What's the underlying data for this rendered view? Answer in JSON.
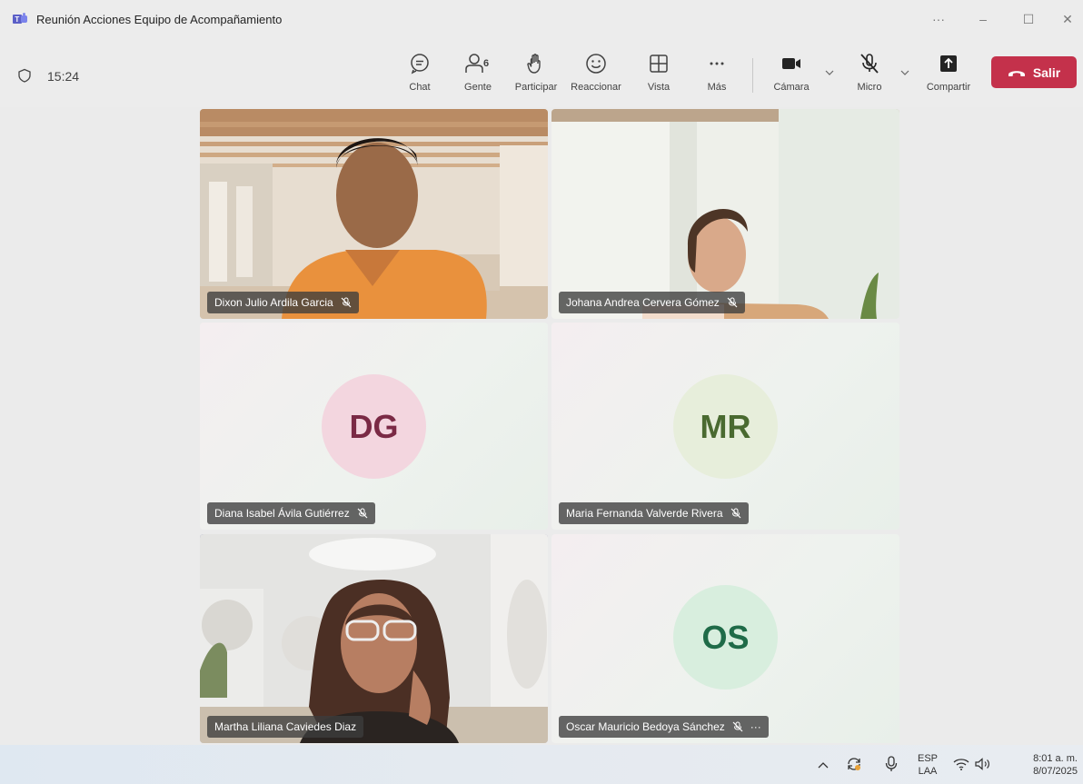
{
  "window": {
    "title": "Reunión Acciones Equipo de Acompañamiento",
    "more": "···",
    "minimize": "–",
    "maximize": "☐",
    "close": "✕"
  },
  "toolbar": {
    "timer": "15:24",
    "people_count": "6",
    "buttons": {
      "chat": "Chat",
      "people": "Gente",
      "raise": "Participar",
      "react": "Reaccionar",
      "view": "Vista",
      "more": "Más",
      "camera": "Cámara",
      "mic": "Micro",
      "share": "Compartir"
    },
    "leave": "Salir"
  },
  "participants": [
    {
      "name": "Dixon Julio Ardila Garcia",
      "type": "video"
    },
    {
      "name": "Johana Andrea Cervera Gómez",
      "type": "video"
    },
    {
      "name": "Diana Isabel Ávila Gutiérrez",
      "type": "avatar",
      "initials": "DG",
      "avatar_bg": "#f3d6df",
      "avatar_fg": "#7a2a45"
    },
    {
      "name": "Maria Fernanda Valverde Rivera",
      "type": "avatar",
      "initials": "MR",
      "avatar_bg": "#e7eedb",
      "avatar_fg": "#4a6a30"
    },
    {
      "name": "Martha Liliana Caviedes Diaz",
      "type": "video",
      "active": true
    },
    {
      "name": "Oscar Mauricio Bedoya Sánchez",
      "type": "avatar",
      "initials": "OS",
      "avatar_bg": "#d8eede",
      "avatar_fg": "#1f6b48",
      "more": "···"
    }
  ],
  "taskbar": {
    "lang_top": "ESP",
    "lang_bottom": "LAA",
    "time": "8:01 a. m.",
    "date": "8/07/2025"
  },
  "colors": {
    "leave": "#c4314b",
    "active_border": "#6264a7",
    "teams_purple": "#5b5fc7"
  }
}
